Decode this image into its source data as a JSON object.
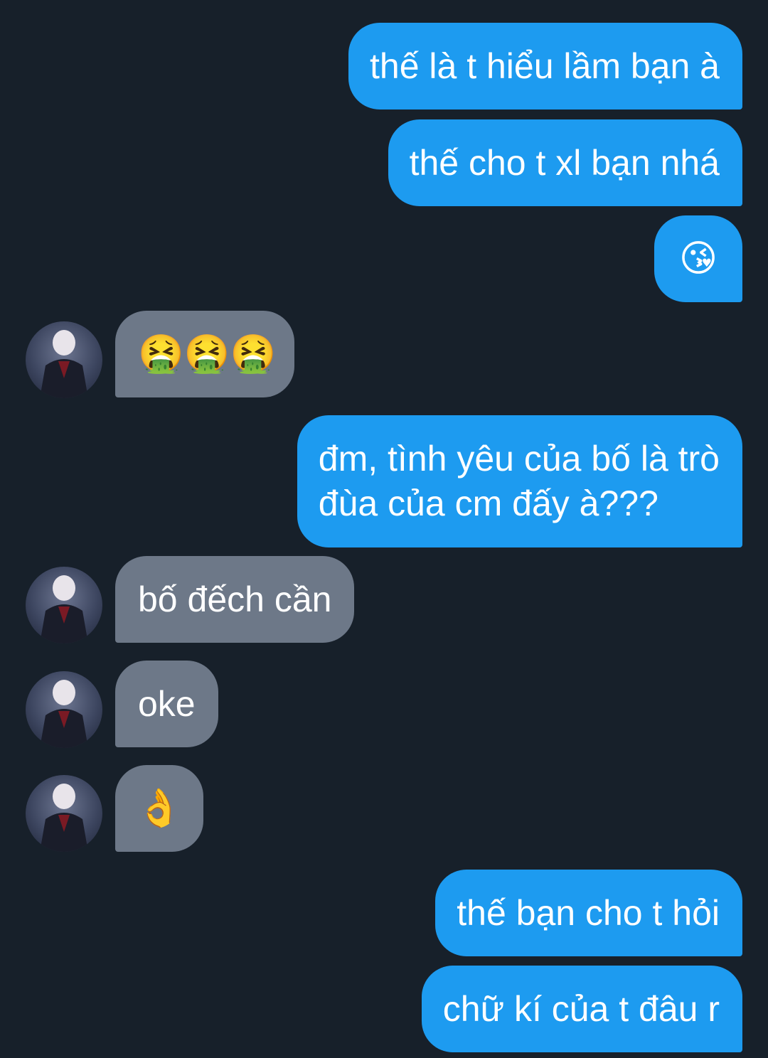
{
  "messages": [
    {
      "side": "out",
      "text": "thế là t hiểu lầm bạn à"
    },
    {
      "side": "out",
      "text": "thế cho t xl bạn nhá"
    },
    {
      "side": "out",
      "text": "😘",
      "emoji_name": "face-blowing-kiss"
    },
    {
      "side": "in",
      "text": "🤮🤮🤮",
      "emoji_name": "vomiting-face"
    },
    {
      "side": "out",
      "text": "đm, tình yêu của bố là trò\nđùa của cm đấy à???"
    },
    {
      "side": "in",
      "text": "bố đếch cần"
    },
    {
      "side": "in",
      "text": "oke"
    },
    {
      "side": "in",
      "text": "👌",
      "emoji_name": "ok-hand"
    },
    {
      "side": "out",
      "text": "thế bạn cho t hỏi"
    },
    {
      "side": "out",
      "text": "chữ kí của t đâu r"
    }
  ],
  "colors": {
    "background": "#17202a",
    "outgoing_bubble": "#1d9bf0",
    "incoming_bubble": "#6d7888",
    "text": "#ffffff"
  },
  "avatar": {
    "icon": "contact-avatar-photo"
  }
}
